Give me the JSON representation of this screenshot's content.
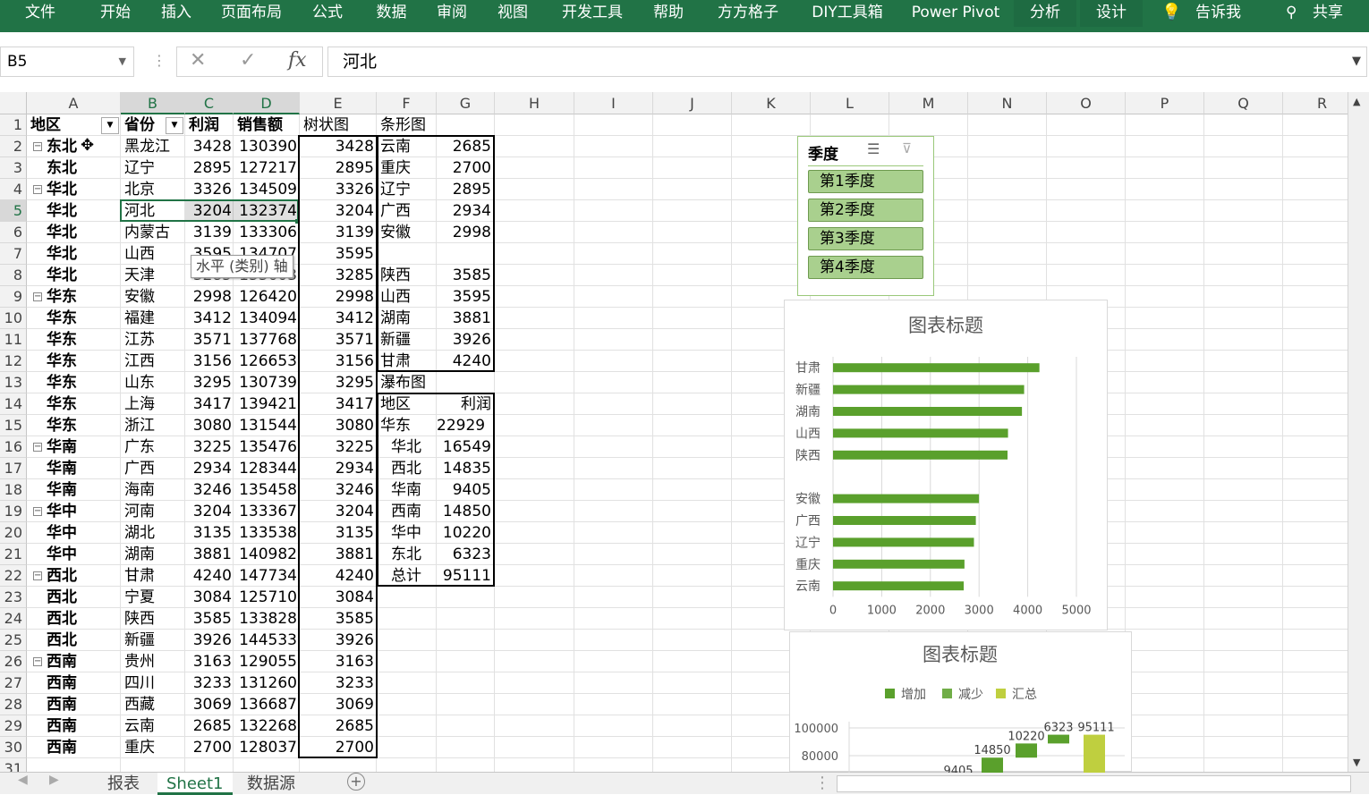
{
  "ribbon": {
    "tabs": [
      "文件",
      "开始",
      "插入",
      "页面布局",
      "公式",
      "数据",
      "审阅",
      "视图",
      "开发工具",
      "帮助",
      "方方格子",
      "DIY工具箱",
      "Power Pivot",
      "分析",
      "设计"
    ],
    "tell": "告诉我",
    "share": "共享"
  },
  "formula_bar": {
    "name_box": "B5",
    "value": "河北",
    "fx": "fx"
  },
  "columns": [
    "A",
    "B",
    "C",
    "D",
    "E",
    "F",
    "G",
    "H",
    "I",
    "J",
    "K",
    "L",
    "M",
    "N",
    "O",
    "P",
    "Q",
    "R"
  ],
  "header_row": {
    "a": "地区",
    "b": "省份",
    "c": "利润",
    "d": "销售额",
    "e": "树状图",
    "f": "条形图"
  },
  "rows": [
    {
      "a": "东北",
      "g": true,
      "b": "黑龙江",
      "c": "3428",
      "d": "130390",
      "e": "3428",
      "f": "云南",
      "v": "2685"
    },
    {
      "a": "东北",
      "b": "辽宁",
      "c": "2895",
      "d": "127217",
      "e": "2895",
      "f": "重庆",
      "v": "2700"
    },
    {
      "a": "华北",
      "g": true,
      "b": "北京",
      "c": "3326",
      "d": "134509",
      "e": "3326",
      "f": "辽宁",
      "v": "2895"
    },
    {
      "a": "华北",
      "b": "河北",
      "c": "3204",
      "d": "132374",
      "e": "3204",
      "f": "广西",
      "v": "2934"
    },
    {
      "a": "华北",
      "b": "内蒙古",
      "c": "3139",
      "d": "133306",
      "e": "3139",
      "f": "安徽",
      "v": "2998"
    },
    {
      "a": "华北",
      "b": "山西",
      "c": "3595",
      "d": "134707",
      "e": "3595",
      "f": "",
      "v": ""
    },
    {
      "a": "华北",
      "b": "天津",
      "c": "3285",
      "d": "133603",
      "e": "3285",
      "f": "陕西",
      "v": "3585"
    },
    {
      "a": "华东",
      "g": true,
      "b": "安徽",
      "c": "2998",
      "d": "126420",
      "e": "2998",
      "f": "山西",
      "v": "3595"
    },
    {
      "a": "华东",
      "b": "福建",
      "c": "3412",
      "d": "134094",
      "e": "3412",
      "f": "湖南",
      "v": "3881"
    },
    {
      "a": "华东",
      "b": "江苏",
      "c": "3571",
      "d": "137768",
      "e": "3571",
      "f": "新疆",
      "v": "3926"
    },
    {
      "a": "华东",
      "b": "江西",
      "c": "3156",
      "d": "126653",
      "e": "3156",
      "f": "甘肃",
      "v": "4240"
    },
    {
      "a": "华东",
      "b": "山东",
      "c": "3295",
      "d": "130739",
      "e": "3295",
      "f": "瀑布图",
      "v": ""
    },
    {
      "a": "华东",
      "b": "上海",
      "c": "3417",
      "d": "139421",
      "e": "3417",
      "f": "地区",
      "v": "利润"
    },
    {
      "a": "华东",
      "b": "浙江",
      "c": "3080",
      "d": "131544",
      "e": "3080",
      "f": "华东",
      "v": "22929"
    },
    {
      "a": "华南",
      "g": true,
      "b": "广东",
      "c": "3225",
      "d": "135476",
      "e": "3225",
      "f": "华北",
      "v": "16549"
    },
    {
      "a": "华南",
      "b": "广西",
      "c": "2934",
      "d": "128344",
      "e": "2934",
      "f": "西北",
      "v": "14835"
    },
    {
      "a": "华南",
      "b": "海南",
      "c": "3246",
      "d": "135458",
      "e": "3246",
      "f": "华南",
      "v": "9405"
    },
    {
      "a": "华中",
      "g": true,
      "b": "河南",
      "c": "3204",
      "d": "133367",
      "e": "3204",
      "f": "西南",
      "v": "14850"
    },
    {
      "a": "华中",
      "b": "湖北",
      "c": "3135",
      "d": "133538",
      "e": "3135",
      "f": "华中",
      "v": "10220"
    },
    {
      "a": "华中",
      "b": "湖南",
      "c": "3881",
      "d": "140982",
      "e": "3881",
      "f": "东北",
      "v": "6323"
    },
    {
      "a": "西北",
      "g": true,
      "b": "甘肃",
      "c": "4240",
      "d": "147734",
      "e": "4240",
      "f": "总计",
      "v": "95111"
    },
    {
      "a": "西北",
      "b": "宁夏",
      "c": "3084",
      "d": "125710",
      "e": "3084",
      "f": "",
      "v": ""
    },
    {
      "a": "西北",
      "b": "陕西",
      "c": "3585",
      "d": "133828",
      "e": "3585",
      "f": "",
      "v": ""
    },
    {
      "a": "西北",
      "b": "新疆",
      "c": "3926",
      "d": "144533",
      "e": "3926",
      "f": "",
      "v": ""
    },
    {
      "a": "西南",
      "g": true,
      "b": "贵州",
      "c": "3163",
      "d": "129055",
      "e": "3163",
      "f": "",
      "v": ""
    },
    {
      "a": "西南",
      "b": "四川",
      "c": "3233",
      "d": "131260",
      "e": "3233",
      "f": "",
      "v": ""
    },
    {
      "a": "西南",
      "b": "西藏",
      "c": "3069",
      "d": "136687",
      "e": "3069",
      "f": "",
      "v": ""
    },
    {
      "a": "西南",
      "b": "云南",
      "c": "2685",
      "d": "132268",
      "e": "2685",
      "f": "",
      "v": ""
    },
    {
      "a": "西南",
      "b": "重庆",
      "c": "2700",
      "d": "128037",
      "e": "2700",
      "f": "",
      "v": ""
    }
  ],
  "tooltip": "水平 (类别) 轴",
  "slicer": {
    "title": "季度",
    "items": [
      "第1季度",
      "第2季度",
      "第3季度",
      "第4季度"
    ]
  },
  "sheets": [
    "报表",
    "Sheet1",
    "数据源"
  ],
  "active_sheet": "Sheet1",
  "chart_data": [
    {
      "type": "bar",
      "title": "图表标题",
      "orientation": "horizontal",
      "categories": [
        "甘肃",
        "新疆",
        "湖南",
        "山西",
        "陕西",
        "",
        "安徽",
        "广西",
        "辽宁",
        "重庆",
        "云南"
      ],
      "values": [
        4240,
        3926,
        3881,
        3595,
        3585,
        null,
        2998,
        2934,
        2895,
        2700,
        2685
      ],
      "xlim": [
        0,
        5000
      ],
      "xticks": [
        "0",
        "1000",
        "2000",
        "3000",
        "4000",
        "5000"
      ],
      "color": "#5aa02c"
    },
    {
      "type": "bar",
      "subtype": "waterfall",
      "title": "图表标题",
      "legend": [
        "增加",
        "减少",
        "汇总"
      ],
      "legend_colors": [
        "#5aa02c",
        "#70ad47",
        "#bfcf3f"
      ],
      "yticks": [
        "100000",
        "80000"
      ],
      "data_labels": [
        "9405",
        "14850",
        "10220",
        "6323",
        "95111"
      ]
    }
  ]
}
